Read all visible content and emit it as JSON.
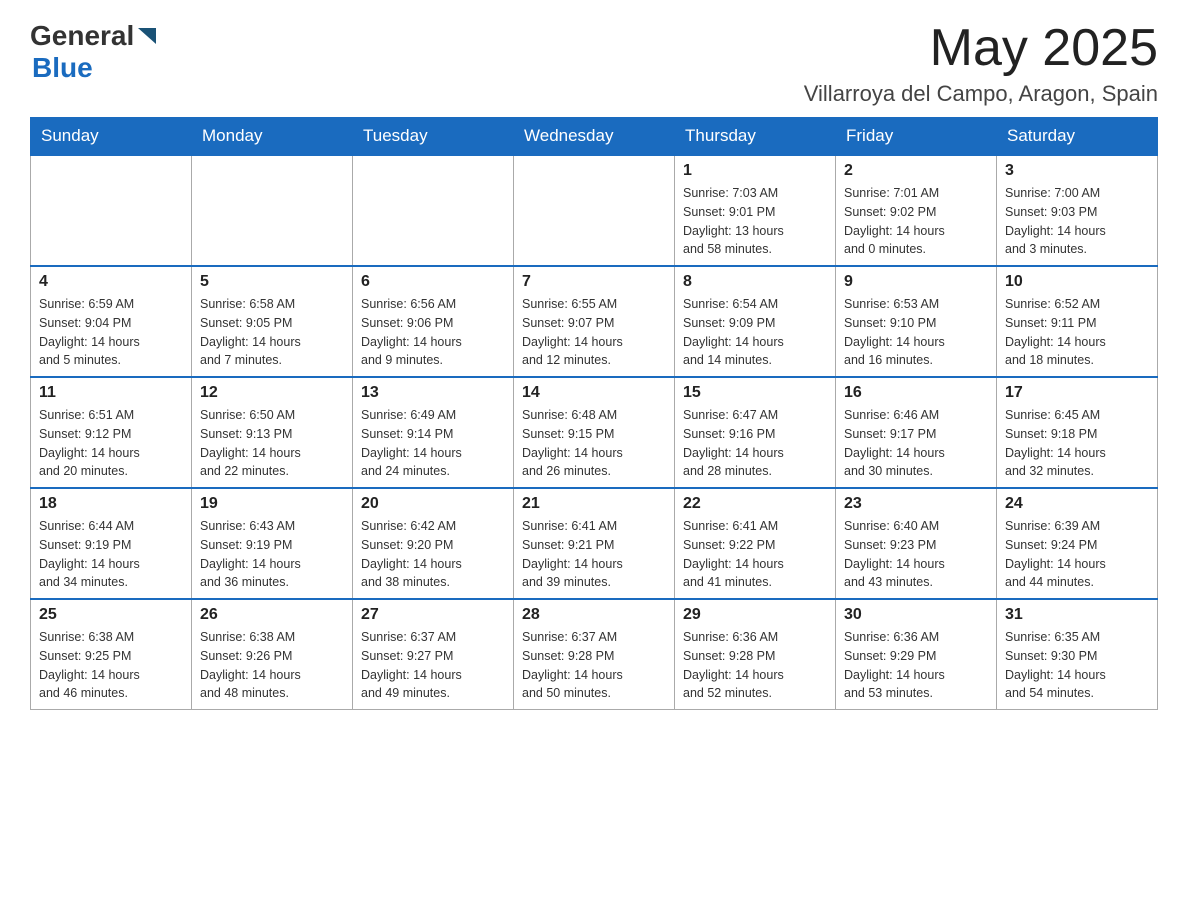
{
  "header": {
    "logo_general": "General",
    "logo_blue": "Blue",
    "month_year": "May 2025",
    "location": "Villarroya del Campo, Aragon, Spain"
  },
  "days_of_week": [
    "Sunday",
    "Monday",
    "Tuesday",
    "Wednesday",
    "Thursday",
    "Friday",
    "Saturday"
  ],
  "weeks": [
    [
      {
        "day": "",
        "info": ""
      },
      {
        "day": "",
        "info": ""
      },
      {
        "day": "",
        "info": ""
      },
      {
        "day": "",
        "info": ""
      },
      {
        "day": "1",
        "info": "Sunrise: 7:03 AM\nSunset: 9:01 PM\nDaylight: 13 hours\nand 58 minutes."
      },
      {
        "day": "2",
        "info": "Sunrise: 7:01 AM\nSunset: 9:02 PM\nDaylight: 14 hours\nand 0 minutes."
      },
      {
        "day": "3",
        "info": "Sunrise: 7:00 AM\nSunset: 9:03 PM\nDaylight: 14 hours\nand 3 minutes."
      }
    ],
    [
      {
        "day": "4",
        "info": "Sunrise: 6:59 AM\nSunset: 9:04 PM\nDaylight: 14 hours\nand 5 minutes."
      },
      {
        "day": "5",
        "info": "Sunrise: 6:58 AM\nSunset: 9:05 PM\nDaylight: 14 hours\nand 7 minutes."
      },
      {
        "day": "6",
        "info": "Sunrise: 6:56 AM\nSunset: 9:06 PM\nDaylight: 14 hours\nand 9 minutes."
      },
      {
        "day": "7",
        "info": "Sunrise: 6:55 AM\nSunset: 9:07 PM\nDaylight: 14 hours\nand 12 minutes."
      },
      {
        "day": "8",
        "info": "Sunrise: 6:54 AM\nSunset: 9:09 PM\nDaylight: 14 hours\nand 14 minutes."
      },
      {
        "day": "9",
        "info": "Sunrise: 6:53 AM\nSunset: 9:10 PM\nDaylight: 14 hours\nand 16 minutes."
      },
      {
        "day": "10",
        "info": "Sunrise: 6:52 AM\nSunset: 9:11 PM\nDaylight: 14 hours\nand 18 minutes."
      }
    ],
    [
      {
        "day": "11",
        "info": "Sunrise: 6:51 AM\nSunset: 9:12 PM\nDaylight: 14 hours\nand 20 minutes."
      },
      {
        "day": "12",
        "info": "Sunrise: 6:50 AM\nSunset: 9:13 PM\nDaylight: 14 hours\nand 22 minutes."
      },
      {
        "day": "13",
        "info": "Sunrise: 6:49 AM\nSunset: 9:14 PM\nDaylight: 14 hours\nand 24 minutes."
      },
      {
        "day": "14",
        "info": "Sunrise: 6:48 AM\nSunset: 9:15 PM\nDaylight: 14 hours\nand 26 minutes."
      },
      {
        "day": "15",
        "info": "Sunrise: 6:47 AM\nSunset: 9:16 PM\nDaylight: 14 hours\nand 28 minutes."
      },
      {
        "day": "16",
        "info": "Sunrise: 6:46 AM\nSunset: 9:17 PM\nDaylight: 14 hours\nand 30 minutes."
      },
      {
        "day": "17",
        "info": "Sunrise: 6:45 AM\nSunset: 9:18 PM\nDaylight: 14 hours\nand 32 minutes."
      }
    ],
    [
      {
        "day": "18",
        "info": "Sunrise: 6:44 AM\nSunset: 9:19 PM\nDaylight: 14 hours\nand 34 minutes."
      },
      {
        "day": "19",
        "info": "Sunrise: 6:43 AM\nSunset: 9:19 PM\nDaylight: 14 hours\nand 36 minutes."
      },
      {
        "day": "20",
        "info": "Sunrise: 6:42 AM\nSunset: 9:20 PM\nDaylight: 14 hours\nand 38 minutes."
      },
      {
        "day": "21",
        "info": "Sunrise: 6:41 AM\nSunset: 9:21 PM\nDaylight: 14 hours\nand 39 minutes."
      },
      {
        "day": "22",
        "info": "Sunrise: 6:41 AM\nSunset: 9:22 PM\nDaylight: 14 hours\nand 41 minutes."
      },
      {
        "day": "23",
        "info": "Sunrise: 6:40 AM\nSunset: 9:23 PM\nDaylight: 14 hours\nand 43 minutes."
      },
      {
        "day": "24",
        "info": "Sunrise: 6:39 AM\nSunset: 9:24 PM\nDaylight: 14 hours\nand 44 minutes."
      }
    ],
    [
      {
        "day": "25",
        "info": "Sunrise: 6:38 AM\nSunset: 9:25 PM\nDaylight: 14 hours\nand 46 minutes."
      },
      {
        "day": "26",
        "info": "Sunrise: 6:38 AM\nSunset: 9:26 PM\nDaylight: 14 hours\nand 48 minutes."
      },
      {
        "day": "27",
        "info": "Sunrise: 6:37 AM\nSunset: 9:27 PM\nDaylight: 14 hours\nand 49 minutes."
      },
      {
        "day": "28",
        "info": "Sunrise: 6:37 AM\nSunset: 9:28 PM\nDaylight: 14 hours\nand 50 minutes."
      },
      {
        "day": "29",
        "info": "Sunrise: 6:36 AM\nSunset: 9:28 PM\nDaylight: 14 hours\nand 52 minutes."
      },
      {
        "day": "30",
        "info": "Sunrise: 6:36 AM\nSunset: 9:29 PM\nDaylight: 14 hours\nand 53 minutes."
      },
      {
        "day": "31",
        "info": "Sunrise: 6:35 AM\nSunset: 9:30 PM\nDaylight: 14 hours\nand 54 minutes."
      }
    ]
  ]
}
